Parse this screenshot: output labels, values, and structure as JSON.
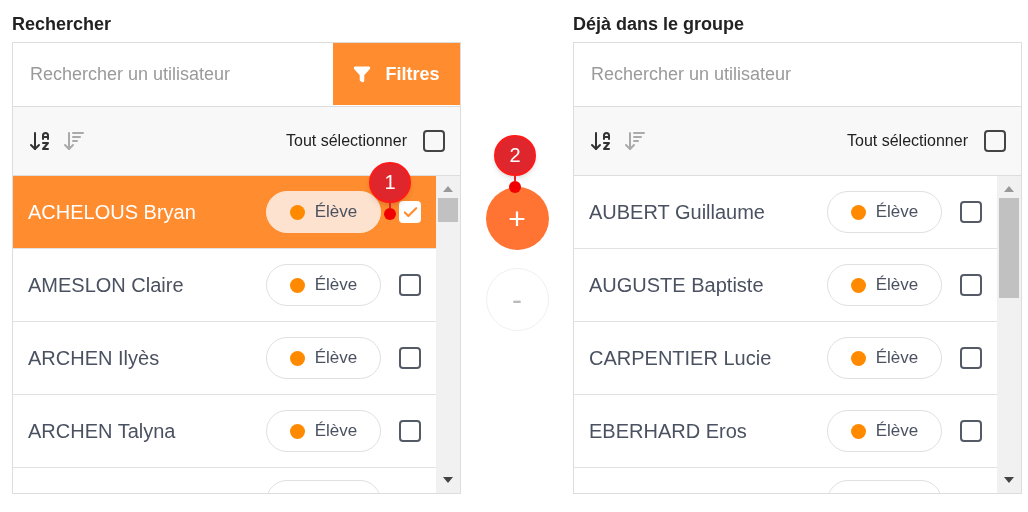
{
  "panels": [
    {
      "title": "Rechercher",
      "search": {
        "placeholder": "Rechercher un utilisateur"
      },
      "filter_button": "Filtres",
      "select_all": {
        "label": "Tout sélectionner",
        "checked": false
      },
      "rows": [
        {
          "name": "ACHELOUS Bryan",
          "role": "Élève",
          "color": "#ff8a00",
          "selected": true,
          "checked": true
        },
        {
          "name": "AMESLON Claire",
          "role": "Élève",
          "color": "#ff8a00",
          "selected": false,
          "checked": false
        },
        {
          "name": "ARCHEN Ilyès",
          "role": "Élève",
          "color": "#ff8a00",
          "selected": false,
          "checked": false
        },
        {
          "name": "ARCHEN Talyna",
          "role": "Élève",
          "color": "#ff8a00",
          "selected": false,
          "checked": false
        }
      ]
    },
    {
      "title": "Déjà dans le groupe",
      "search": {
        "placeholder": "Rechercher un utilisateur"
      },
      "select_all": {
        "label": "Tout sélectionner",
        "checked": false
      },
      "rows": [
        {
          "name": "AUBERT Guillaume",
          "role": "Élève",
          "color": "#ff8a00",
          "selected": false,
          "checked": false
        },
        {
          "name": "AUGUSTE Baptiste",
          "role": "Élève",
          "color": "#ff8a00",
          "selected": false,
          "checked": false
        },
        {
          "name": "CARPENTIER Lucie",
          "role": "Élève",
          "color": "#ff8a00",
          "selected": false,
          "checked": false
        },
        {
          "name": "EBERHARD Eros",
          "role": "Élève",
          "color": "#ff8a00",
          "selected": false,
          "checked": false
        }
      ]
    }
  ],
  "add_button": {
    "label": "+",
    "disabled": false
  },
  "remove_button": {
    "label": "-",
    "disabled": true
  },
  "annotations": [
    "1",
    "2"
  ]
}
